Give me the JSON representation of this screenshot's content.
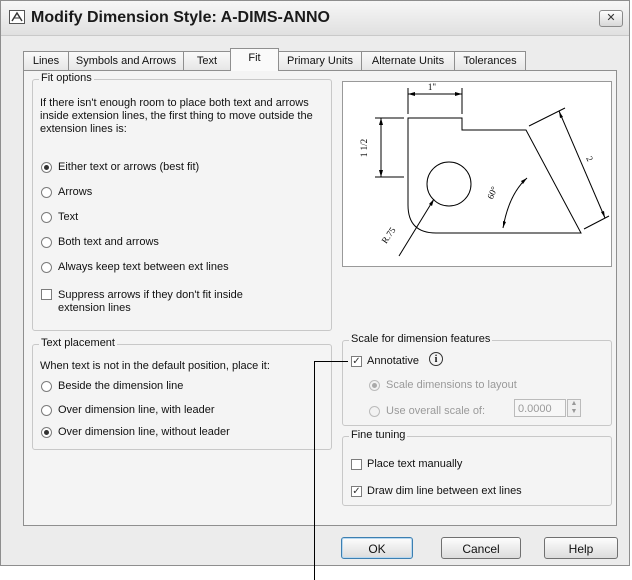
{
  "window": {
    "title": "Modify Dimension Style: A-DIMS-ANNO",
    "close_symbol": "✕"
  },
  "tabs": [
    "Lines",
    "Symbols and Arrows",
    "Text",
    "Fit",
    "Primary Units",
    "Alternate Units",
    "Tolerances"
  ],
  "active_tab": "Fit",
  "fit_options": {
    "title": "Fit options",
    "description": "If there isn't enough room to place both text and arrows inside extension lines, the first thing to move outside the extension lines is:",
    "options": [
      "Either text or arrows (best fit)",
      "Arrows",
      "Text",
      "Both text and arrows",
      "Always keep text between ext lines"
    ],
    "selected": "Either text or arrows (best fit)",
    "suppress_label": "Suppress arrows if they don't fit inside extension lines",
    "suppress_checked": false
  },
  "preview": {
    "dim_top": "1\"",
    "dim_left": "1 1/2",
    "dim_right": "2",
    "dim_angle": "60°",
    "dim_radius": "R.75"
  },
  "text_placement": {
    "title": "Text placement",
    "description": "When text is not in the default position, place it:",
    "options": [
      "Beside the dimension line",
      "Over dimension line, with leader",
      "Over dimension line, without leader"
    ],
    "selected": "Over dimension line, without leader"
  },
  "scale": {
    "title": "Scale for dimension features",
    "annotative_label": "Annotative",
    "annotative_checked": true,
    "info_symbol": "i",
    "layout_label": "Scale dimensions to layout",
    "overall_label": "Use overall scale of:",
    "overall_value": "0.0000"
  },
  "fine_tuning": {
    "title": "Fine tuning",
    "manual_label": "Place text manually",
    "manual_checked": false,
    "drawdim_label": "Draw dim line between ext lines",
    "drawdim_checked": true
  },
  "buttons": {
    "ok": "OK",
    "cancel": "Cancel",
    "help": "Help"
  }
}
